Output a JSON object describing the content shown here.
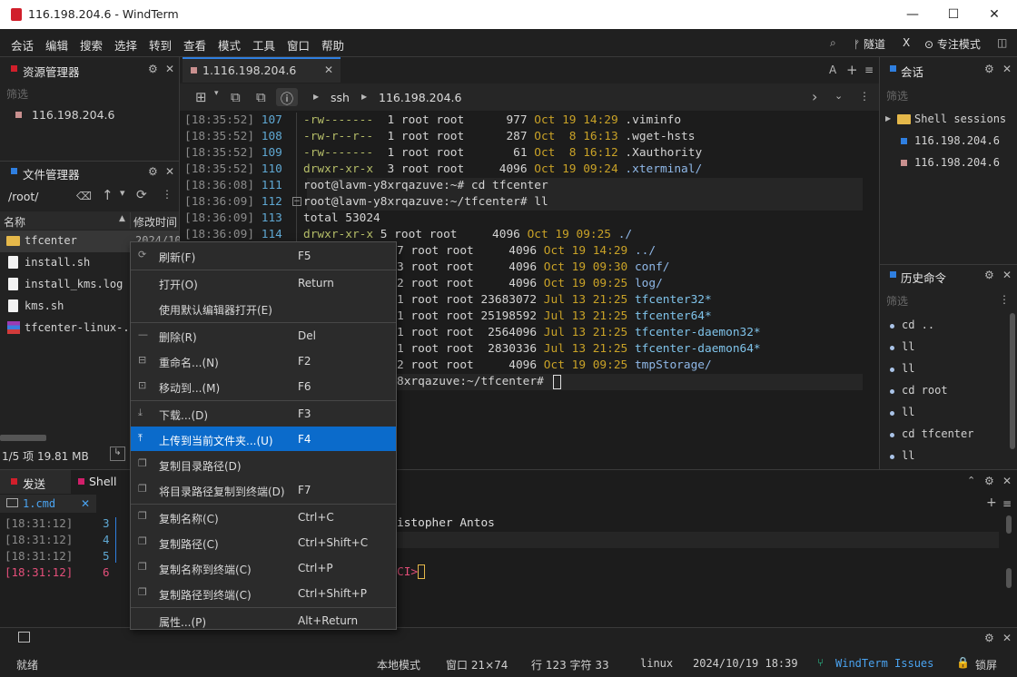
{
  "window": {
    "title": "116.198.204.6 - WindTerm"
  },
  "menu": [
    "会话",
    "编辑",
    "搜索",
    "选择",
    "转到",
    "查看",
    "模式",
    "工具",
    "窗口",
    "帮助"
  ],
  "menu_right": {
    "tunnel": "隧道",
    "focus": "专注模式"
  },
  "resource_manager": {
    "title": "资源管理器",
    "filter_placeholder": "筛选",
    "host": "116.198.204.6"
  },
  "file_manager": {
    "title": "文件管理器",
    "path": "/root/",
    "col_name": "名称",
    "col_mtime": "修改时间",
    "files": [
      {
        "name": "tfcenter",
        "date": "2024/10"
      },
      {
        "name": "install.sh"
      },
      {
        "name": "install_kms.log"
      },
      {
        "name": "kms.sh"
      },
      {
        "name": "tfcenter-linux-..."
      }
    ],
    "status": "1/5 项 19.81 MB"
  },
  "terminal": {
    "tab_label": "1.116.198.204.6",
    "tab_close": "✕",
    "addr_ssh": "ssh",
    "addr_host": "116.198.204.6",
    "font_letter": "A",
    "lines": [
      {
        "ts": "[18:35:52]",
        "n": "107",
        "perm": "-rw-------",
        "rest": "  1 root root      977 ",
        "date": "Oct 19 14:29",
        "name": " .viminfo",
        "ntype": "plain"
      },
      {
        "ts": "[18:35:52]",
        "n": "108",
        "perm": "-rw-r--r--",
        "rest": "  1 root root      287 ",
        "date": "Oct  8 16:13",
        "name": " .wget-hsts",
        "ntype": "plain"
      },
      {
        "ts": "[18:35:52]",
        "n": "109",
        "perm": "-rw-------",
        "rest": "  1 root root       61 ",
        "date": "Oct  8 16:12",
        "name": " .Xauthority",
        "ntype": "plain"
      },
      {
        "ts": "[18:35:52]",
        "n": "110",
        "perm": "drwxr-xr-x",
        "rest": "  3 root root     4096 ",
        "date": "Oct 19 09:24",
        "name": " .xterminal/",
        "ntype": "dir"
      },
      {
        "ts": "[18:36:08]",
        "n": "111",
        "prompt": "root@lavm-y8xrqazuve:~",
        "cmd": "# cd tfcenter"
      },
      {
        "ts": "[18:36:09]",
        "n": "112",
        "prompt": "root@lavm-y8xrqazuve:~/tfcenter",
        "cmd": "# ll"
      },
      {
        "ts": "[18:36:09]",
        "n": "113",
        "text": "total 53024"
      },
      {
        "ts": "[18:36:09]",
        "n": "114",
        "perm": "drwxr-xr-x",
        "rest": " 5 root root     4096 ",
        "date": "Oct 19 09:25",
        "name": " ./",
        "ntype": "dir"
      }
    ],
    "partial_lines": [
      {
        "rest": "7 root root     4096 ",
        "date": "Oct 19 14:29",
        "name": " ../",
        "ntype": "dir"
      },
      {
        "rest": "3 root root     4096 ",
        "date": "Oct 19 09:30",
        "name": " conf/",
        "ntype": "dir"
      },
      {
        "rest": "2 root root     4096 ",
        "date": "Oct 19 09:25",
        "name": " log/",
        "ntype": "dir"
      },
      {
        "rest": "1 root root 23683072 ",
        "date": "Jul 13 21:25",
        "name": " tfcenter32*",
        "ntype": "exe"
      },
      {
        "rest": "1 root root 25198592 ",
        "date": "Jul 13 21:25",
        "name": " tfcenter64*",
        "ntype": "exe"
      },
      {
        "rest": "1 root root  2564096 ",
        "date": "Jul 13 21:25",
        "name": " tfcenter-daemon32*",
        "ntype": "exe"
      },
      {
        "rest": "1 root root  2830336 ",
        "date": "Jul 13 21:25",
        "name": " tfcenter-daemon64*",
        "ntype": "exe"
      },
      {
        "rest": "2 root root     4096 ",
        "date": "Oct 19 09:25",
        "name": " tmpStorage/",
        "ntype": "dir"
      }
    ],
    "last_prompt": "8xrqazuve:~/tfcenter",
    "last_hash": "#"
  },
  "sessions": {
    "title": "会话",
    "filter_placeholder": "筛选",
    "group": "Shell sessions",
    "items": [
      {
        "name": "116.198.204.6",
        "color": "#2f7fe0"
      },
      {
        "name": "116.198.204.6",
        "color": "#c9908f"
      }
    ]
  },
  "history": {
    "title": "历史命令",
    "filter_placeholder": "筛选",
    "items": [
      "cd ..",
      "ll",
      "ll",
      "cd root",
      "ll",
      "cd tfcenter",
      "ll"
    ]
  },
  "send": {
    "tab_send": "发送",
    "tab_shell": "Shell",
    "cmd_tab": "1.cmd",
    "lines": [
      {
        "ts": "[18:31:12]",
        "n": "3"
      },
      {
        "ts": "[18:31:12]",
        "n": "4"
      },
      {
        "ts": "[18:31:12]",
        "n": "5"
      },
      {
        "ts": "[18:31:12]",
        "n": "6"
      }
    ],
    "shell_text": "istopher Antos",
    "shell_prompt": "CI>"
  },
  "context_menu": [
    {
      "label": "刷新(F)",
      "shortcut": "F5",
      "icon": "refresh-icon",
      "glyph": "⟳"
    },
    {
      "sep": true
    },
    {
      "label": "打开(O)",
      "shortcut": "Return",
      "icon": "",
      "glyph": ""
    },
    {
      "label": "使用默认编辑器打开(E)",
      "shortcut": "",
      "icon": "",
      "glyph": ""
    },
    {
      "sep": true
    },
    {
      "label": "删除(R)",
      "shortcut": "Del",
      "icon": "minus-icon",
      "glyph": "—"
    },
    {
      "label": "重命名...(N)",
      "shortcut": "F2",
      "icon": "rename-icon",
      "glyph": "⊟"
    },
    {
      "label": "移动到...(M)",
      "shortcut": "F6",
      "icon": "move-icon",
      "glyph": "⊡"
    },
    {
      "sep": true
    },
    {
      "label": "下载...(D)",
      "shortcut": "F3",
      "icon": "download-icon",
      "glyph": "⤓"
    },
    {
      "label": "上传到当前文件夹...(U)",
      "shortcut": "F4",
      "icon": "upload-icon",
      "glyph": "⤒",
      "highlight": true
    },
    {
      "label": "复制目录路径(D)",
      "shortcut": "",
      "icon": "copy-icon",
      "glyph": "❐"
    },
    {
      "label": "将目录路径复制到终端(D)",
      "shortcut": "F7",
      "icon": "copy-icon",
      "glyph": "❐"
    },
    {
      "sep": true
    },
    {
      "label": "复制名称(C)",
      "shortcut": "Ctrl+C",
      "icon": "copy-icon",
      "glyph": "❐"
    },
    {
      "label": "复制路径(C)",
      "shortcut": "Ctrl+Shift+C",
      "icon": "copy-icon",
      "glyph": "❐"
    },
    {
      "label": "复制名称到终端(C)",
      "shortcut": "Ctrl+P",
      "icon": "copy-icon",
      "glyph": "❐"
    },
    {
      "label": "复制路径到终端(C)",
      "shortcut": "Ctrl+Shift+P",
      "icon": "copy-icon",
      "glyph": "❐"
    },
    {
      "sep": true
    },
    {
      "label": "属性...(P)",
      "shortcut": "Alt+Return",
      "icon": "",
      "glyph": ""
    }
  ],
  "statusbar": {
    "ready": "就绪",
    "mode": "本地模式",
    "window_size": "窗口 21×74",
    "position": "行 123 字符 33",
    "os": "linux",
    "datetime": "2024/10/19 18:39",
    "issues": "WindTerm Issues",
    "lock": "锁屏"
  }
}
